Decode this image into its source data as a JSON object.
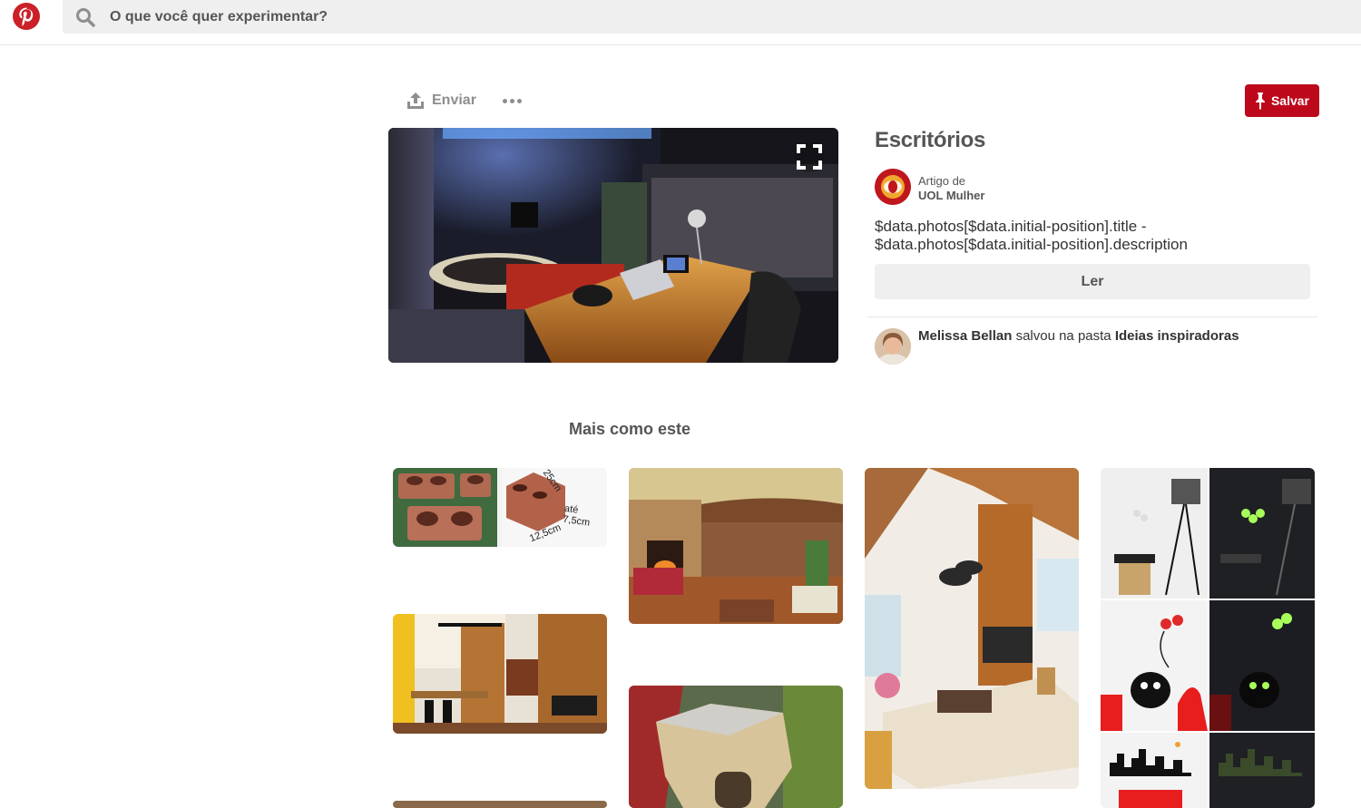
{
  "header": {
    "logo_icon": "pinterest-logo",
    "search_icon": "search-icon",
    "search_placeholder": "O que você quer experimentar?"
  },
  "actions": {
    "share_label": "Enviar",
    "share_icon": "upload-icon",
    "more_icon": "ellipsis-icon",
    "save_label": "Salvar",
    "save_icon": "pushpin-icon",
    "accent": "#bd081c"
  },
  "pin": {
    "title": "Escritórios",
    "source_prefix": "Artigo de",
    "source_name": "UOL Mulher",
    "description": "$data.photos[$data.initial-position].title - $data.photos[$data.initial-position].description",
    "read_label": "Ler",
    "expand_icon": "expand-icon"
  },
  "saver": {
    "name": "Melissa Bellan",
    "action": "salvou na pasta",
    "board": "Ideias inspiradoras"
  },
  "related": {
    "title": "Mais como este",
    "brick_labels": [
      "25cm",
      "até 7,5cm",
      "12,5cm"
    ]
  }
}
